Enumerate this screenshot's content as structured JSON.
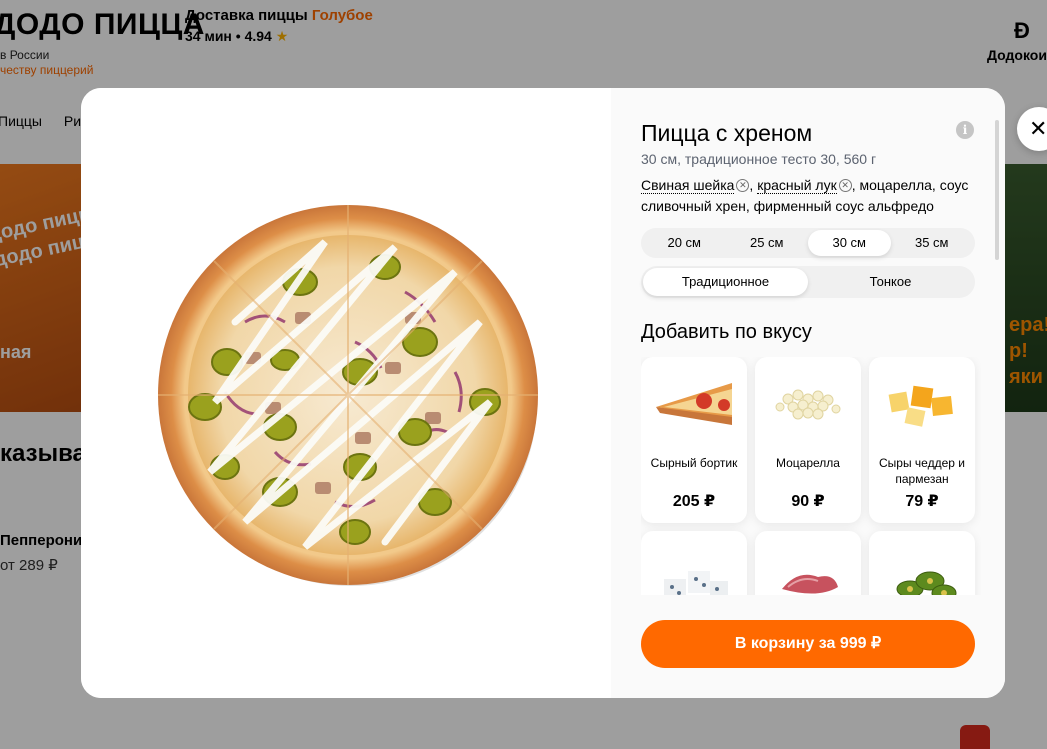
{
  "header": {
    "logo_text": "ДОДО ПИЦЦА",
    "logo_sub1": "в России",
    "logo_sub2": "честву пиццерий",
    "delivery_label": "Доставка пиццы",
    "delivery_city": "Голубое",
    "delivery_time": "34 мин",
    "rating": "4.94",
    "dodocoins_label": "Додокоины"
  },
  "background": {
    "nav_items": [
      "Пиццы",
      "Римские"
    ],
    "banner_text": "додо пицца\nдодо пицца",
    "banner_note": "ная",
    "right_banner_text": "ера!\nр!\nяки",
    "section_heading": "казыва",
    "product_name": "Пепперони",
    "product_price": "от 289 ₽"
  },
  "modal": {
    "title": "Пицца с хреном",
    "subtitle": "30 см, традиционное тесто 30, 560 г",
    "ingredients": {
      "removable": [
        "Свиная шейка",
        "красный лук"
      ],
      "rest": ", моцарелла, соус сливочный хрен, фирменный соус альфредо"
    },
    "sizes": [
      "20 см",
      "25 см",
      "30 см",
      "35 см"
    ],
    "selected_size": "30 см",
    "doughs": [
      "Традиционное",
      "Тонкое"
    ],
    "selected_dough": "Традиционное",
    "addons_heading": "Добавить по вкусу",
    "addons": [
      {
        "name": "Сырный бортик",
        "price": "205 ₽",
        "icon": "cheese-crust"
      },
      {
        "name": "Моцарелла",
        "price": "90 ₽",
        "icon": "mozzarella"
      },
      {
        "name": "Сыры чеддер и пармезан",
        "price": "79 ₽",
        "icon": "cheddar-parmesan"
      },
      {
        "name": "",
        "price": "",
        "icon": "blue-cheese"
      },
      {
        "name": "",
        "price": "",
        "icon": "ham"
      },
      {
        "name": "",
        "price": "",
        "icon": "jalapeno"
      }
    ],
    "cart_button": "В корзину за 999 ₽",
    "colors": {
      "accent": "#ff6900",
      "overlay": "rgba(0,0,0,0.38)"
    }
  }
}
